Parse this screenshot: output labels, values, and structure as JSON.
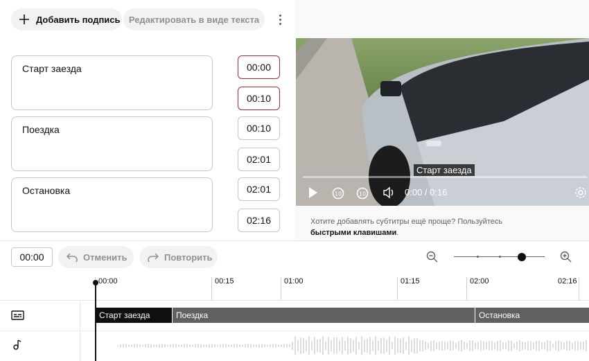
{
  "toolbar": {
    "add_label": "Добавить подпись",
    "edit_label": "Редактировать в виде текста"
  },
  "captions": [
    {
      "text": "Старт заезда",
      "start": "00:00",
      "end": "00:10"
    },
    {
      "text": "Поездка",
      "start": "00:10",
      "end": "02:01"
    },
    {
      "text": "Остановка",
      "start": "02:01",
      "end": "02:16"
    }
  ],
  "video": {
    "overlay_caption": "Старт заезда",
    "time_readout": "0:00 / 0:16",
    "hint_text": "Хотите добавлять субтитры ещё проще? Пользуйтесь",
    "hint_link": "быстрыми клавишами",
    "hint_end": "."
  },
  "timeline": {
    "current_time": "00:00",
    "undo_label": "Отменить",
    "redo_label": "Повторить",
    "ruler": [
      "00:00",
      "00:15",
      "01:00",
      "01:15",
      "02:00",
      "02:16"
    ],
    "segments": [
      "Старт заезда",
      "Поездка",
      "Остановка"
    ],
    "zoom_level": 0.75
  },
  "colors": {
    "error_border": "#b3262d",
    "segment_active": "#0f0f0f",
    "segment": "#606060"
  }
}
